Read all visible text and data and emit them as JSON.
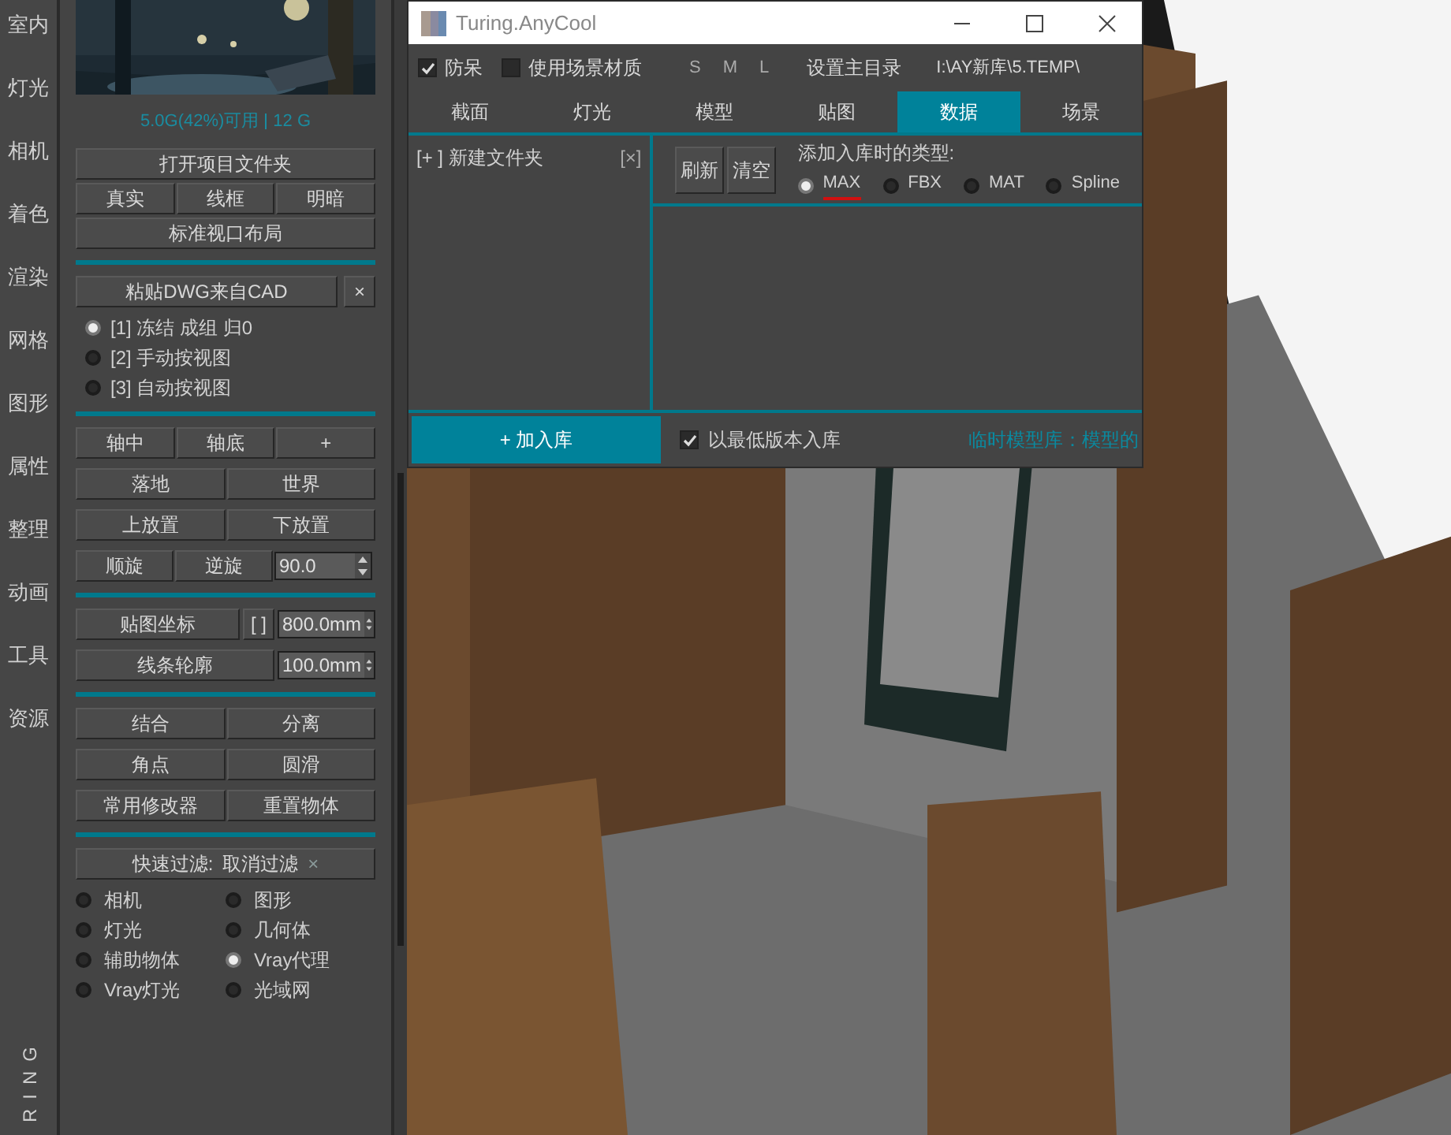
{
  "side_nav": [
    {
      "label": "室内"
    },
    {
      "label": "灯光"
    },
    {
      "label": "相机"
    },
    {
      "label": "着色"
    },
    {
      "label": "渲染"
    },
    {
      "label": "网格"
    },
    {
      "label": "图形"
    },
    {
      "label": "属性"
    },
    {
      "label": "整理"
    },
    {
      "label": "动画"
    },
    {
      "label": "工具"
    },
    {
      "label": "资源"
    }
  ],
  "side_brand": "RING",
  "panel": {
    "memory": "5.0G(42%)可用",
    "memory_total": "12 G",
    "open_folder": "打开项目文件夹",
    "view_modes": [
      "真实",
      "线框",
      "明暗"
    ],
    "layout_button": "标准视口布局",
    "paste_dwg": "粘贴DWG来自CAD",
    "paste_close": "×",
    "dwg_options": [
      {
        "label": "[1] 冻结 成组 归0",
        "selected": true
      },
      {
        "label": "[2] 手动按视图",
        "selected": false
      },
      {
        "label": "[3] 自动按视图",
        "selected": false
      }
    ],
    "pivot_buttons": [
      "轴中",
      "轴底",
      "+"
    ],
    "place_rows": [
      [
        "落地",
        "世界"
      ],
      [
        "上放置",
        "下放置"
      ]
    ],
    "rotate": [
      "顺旋",
      "逆旋"
    ],
    "rotate_value": "90.0",
    "map_coords": "贴图坐标",
    "map_bracket": "[ ]",
    "map_value": "800.0mm",
    "outline": "线条轮廓",
    "outline_value": "100.0mm",
    "edit_rows": [
      [
        "结合",
        "分离"
      ],
      [
        "角点",
        "圆滑"
      ],
      [
        "常用修改器",
        "重置物体"
      ]
    ],
    "filter_label": "快速过滤:",
    "filter_cancel": "取消过滤",
    "filter_x": "×",
    "filters": [
      {
        "label": "相机",
        "selected": false
      },
      {
        "label": "图形",
        "selected": false
      },
      {
        "label": "灯光",
        "selected": false
      },
      {
        "label": "几何体",
        "selected": false
      },
      {
        "label": "辅助物体",
        "selected": false
      },
      {
        "label": "Vray代理",
        "selected": true
      },
      {
        "label": "Vray灯光",
        "selected": false
      },
      {
        "label": "光域网",
        "selected": false
      }
    ]
  },
  "window": {
    "title": "Turing.AnyCool",
    "options": [
      {
        "label": "防呆",
        "checked": true
      },
      {
        "label": "使用场景材质",
        "checked": false
      }
    ],
    "sizes": [
      "S",
      "M",
      "L"
    ],
    "set_dir": "设置主目录",
    "path": "I:\\AY新库\\5.TEMP\\",
    "tabs": [
      {
        "label": "截面",
        "selected": false
      },
      {
        "label": "灯光",
        "selected": false
      },
      {
        "label": "模型",
        "selected": false
      },
      {
        "label": "贴图",
        "selected": false
      },
      {
        "label": "数据",
        "selected": true
      },
      {
        "label": "场景",
        "selected": false
      }
    ],
    "new_folder": "[+ ] 新建文件夹",
    "folder_close": "[×]",
    "actions": [
      "刷新",
      "清空"
    ],
    "type_label": "添加入库时的类型:",
    "types": [
      {
        "label": "MAX",
        "selected": true
      },
      {
        "label": "FBX",
        "selected": false
      },
      {
        "label": "MAT",
        "selected": false
      },
      {
        "label": "Spline",
        "selected": false
      }
    ],
    "add_button": "+ 加入库",
    "lowest_version": {
      "label": "以最低版本入库",
      "checked": true
    },
    "status": "临时模型库：模型的"
  }
}
